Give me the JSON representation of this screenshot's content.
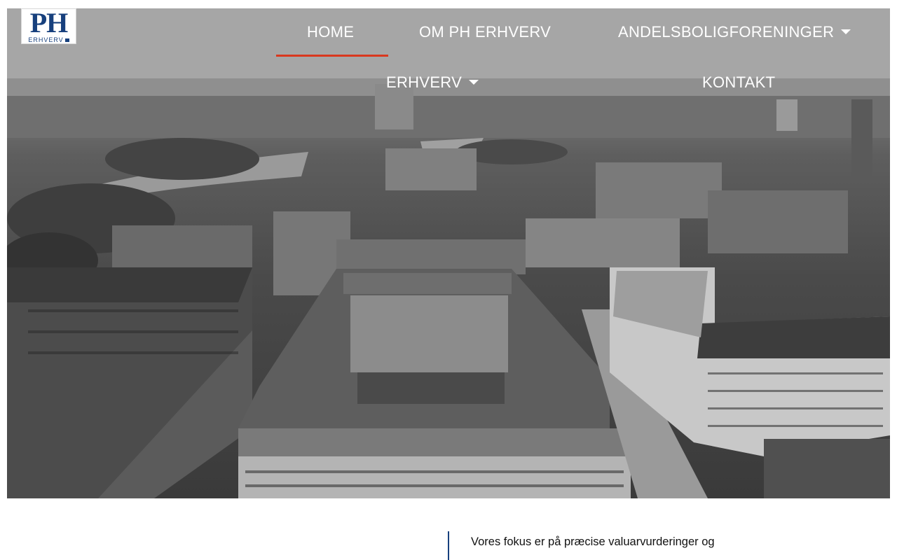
{
  "logo": {
    "main": "PH",
    "sub": "ERHVERV",
    "icon": "house-icon"
  },
  "nav": {
    "items": [
      {
        "label": "HOME",
        "active": true,
        "has_dropdown": false
      },
      {
        "label": "OM PH ERHVERV",
        "active": false,
        "has_dropdown": false
      },
      {
        "label": "ANDELSBOLIGFORENINGER",
        "active": false,
        "has_dropdown": true
      },
      {
        "label": "ERHVERV",
        "active": false,
        "has_dropdown": true
      },
      {
        "label": "KONTAKT",
        "active": false,
        "has_dropdown": false
      }
    ],
    "dropdown_icon": "caret-down-icon"
  },
  "hero": {
    "image": "aerial-city-photo"
  },
  "content": {
    "intro": "Vores fokus er på præcise valuarvurderinger og"
  },
  "colors": {
    "brand_blue": "#17407d",
    "active_underline": "#d9381e",
    "nav_text": "#ffffff"
  }
}
